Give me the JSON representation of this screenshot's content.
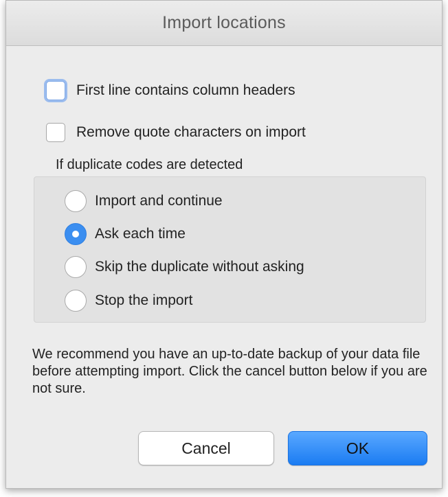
{
  "dialog": {
    "title": "Import locations"
  },
  "options": {
    "first_line_headers": {
      "label": "First line contains column headers",
      "checked": false
    },
    "remove_quotes": {
      "label": "Remove quote characters on import",
      "checked": false
    }
  },
  "duplicates": {
    "label": "If duplicate codes are detected",
    "choices": [
      {
        "label": "Import and continue",
        "selected": false
      },
      {
        "label": "Ask each time",
        "selected": true
      },
      {
        "label": "Skip the duplicate without asking",
        "selected": false
      },
      {
        "label": "Stop the import",
        "selected": false
      }
    ]
  },
  "note": "We recommend you have an up-to-date backup of your data file before attempting import. Click the cancel button below if you are not sure.",
  "buttons": {
    "cancel": "Cancel",
    "ok": "OK"
  },
  "colors": {
    "accent": "#3b8ef0",
    "window_bg": "#ececec",
    "group_bg": "#e2e2e2"
  }
}
